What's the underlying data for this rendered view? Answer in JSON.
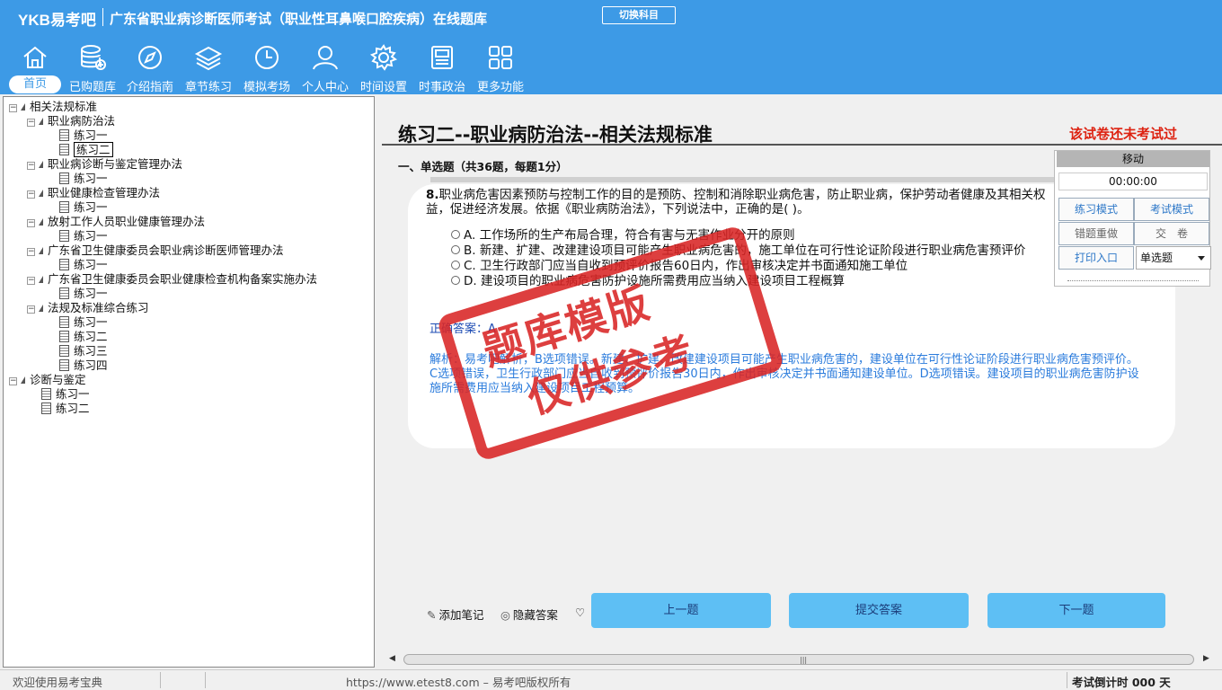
{
  "header": {
    "brand": "YKB易考吧",
    "app_title": "广东省职业病诊断医师考试（职业性耳鼻喉口腔疾病）在线题库",
    "switch_button": "切换科目"
  },
  "nav": [
    {
      "label": "首页",
      "icon": "home-icon"
    },
    {
      "label": "已购题库",
      "icon": "database-add-icon"
    },
    {
      "label": "介绍指南",
      "icon": "compass-icon"
    },
    {
      "label": "章节练习",
      "icon": "layers-icon"
    },
    {
      "label": "模拟考场",
      "icon": "clock-icon"
    },
    {
      "label": "个人中心",
      "icon": "user-icon"
    },
    {
      "label": "时间设置",
      "icon": "gear-icon"
    },
    {
      "label": "时事政治",
      "icon": "newspaper-icon"
    },
    {
      "label": "更多功能",
      "icon": "grid-icon"
    }
  ],
  "tree": [
    {
      "label": "相关法规标准",
      "type": "folder",
      "level": 0
    },
    {
      "label": "职业病防治法",
      "type": "folder",
      "level": 1
    },
    {
      "label": "练习一",
      "type": "doc",
      "level": 2
    },
    {
      "label": "练习二",
      "type": "doc",
      "level": 2,
      "selected": true
    },
    {
      "label": "职业病诊断与鉴定管理办法",
      "type": "folder",
      "level": 1
    },
    {
      "label": "练习一",
      "type": "doc",
      "level": 2
    },
    {
      "label": "职业健康检查管理办法",
      "type": "folder",
      "level": 1
    },
    {
      "label": "练习一",
      "type": "doc",
      "level": 2
    },
    {
      "label": "放射工作人员职业健康管理办法",
      "type": "folder",
      "level": 1
    },
    {
      "label": "练习一",
      "type": "doc",
      "level": 2
    },
    {
      "label": "广东省卫生健康委员会职业病诊断医师管理办法",
      "type": "folder",
      "level": 1
    },
    {
      "label": "练习一",
      "type": "doc",
      "level": 2
    },
    {
      "label": "广东省卫生健康委员会职业健康检查机构备案实施办法",
      "type": "folder",
      "level": 1
    },
    {
      "label": "练习一",
      "type": "doc",
      "level": 2
    },
    {
      "label": "法规及标准综合练习",
      "type": "folder",
      "level": 1
    },
    {
      "label": "练习一",
      "type": "doc",
      "level": 2
    },
    {
      "label": "练习二",
      "type": "doc",
      "level": 2
    },
    {
      "label": "练习三",
      "type": "doc",
      "level": 2
    },
    {
      "label": "练习四",
      "type": "doc",
      "level": 2
    },
    {
      "label": "诊断与鉴定",
      "type": "folder",
      "level": 0
    },
    {
      "label": "练习一",
      "type": "doc",
      "level": 1
    },
    {
      "label": "练习二",
      "type": "doc",
      "level": 1
    }
  ],
  "exam": {
    "title": "练习二--职业病防治法--相关法规标准",
    "status": "该试卷还未考试过",
    "section_title": "一、单选题（共36题，每题1分）"
  },
  "question": {
    "number": "8.",
    "text": "职业病危害因素预防与控制工作的目的是预防、控制和消除职业病危害，防止职业病，保护劳动者健康及其相关权益，促进经济发展。依据《职业病防治法》，下列说法中，正确的是( )。",
    "options": [
      "A. 工作场所的生产布局合理，符合有害与无害作业分开的原则",
      "B. 新建、扩建、改建建设项目可能产生职业病危害的，施工单位在可行性论证阶段进行职业病危害预评价",
      "C. 卫生行政部门应当自收到预评价报告60日内，作出审核决定并书面通知施工单位",
      "D. 建设项目的职业病危害防护设施所需费用应当纳入建设项目工程概算"
    ],
    "answer_label": "正确答案：",
    "answer_value": "A",
    "analysis": "解析：易考吧解析，B选项错误。新建、扩建、改建建设项目可能产生职业病危害的，建设单位在可行性论证阶段进行职业病危害预评价。C选项错误，卫生行政部门应当自收到预评价报告30日内，作出审核决定并书面通知建设单位。D选项错误。建设项目的职业病危害防护设施所需费用应当纳入建设项目工程预算。"
  },
  "control": {
    "move": "移动",
    "timer": "00:00:00",
    "practice_mode": "练习模式",
    "exam_mode": "考试模式",
    "redo_wrong": "错题重做",
    "submit_paper": "交　卷",
    "print": "打印入口",
    "type_select": "单选题"
  },
  "actions": {
    "add_note": "添加笔记",
    "hide_answer": "隐藏答案",
    "prev": "上一题",
    "submit": "提交答案",
    "next": "下一题"
  },
  "statusbar": {
    "welcome": "欢迎使用易考宝典",
    "copyright": "https://www.etest8.com – 易考吧版权所有",
    "countdown": "考试倒计时 000 天"
  },
  "watermark": {
    "line1": "题库模版",
    "line2": "仅供参考"
  },
  "colors": {
    "header_bg": "#3d9ae6",
    "accent_button": "#5ebff4",
    "status_red": "#d21",
    "stamp_red": "#d92525"
  }
}
